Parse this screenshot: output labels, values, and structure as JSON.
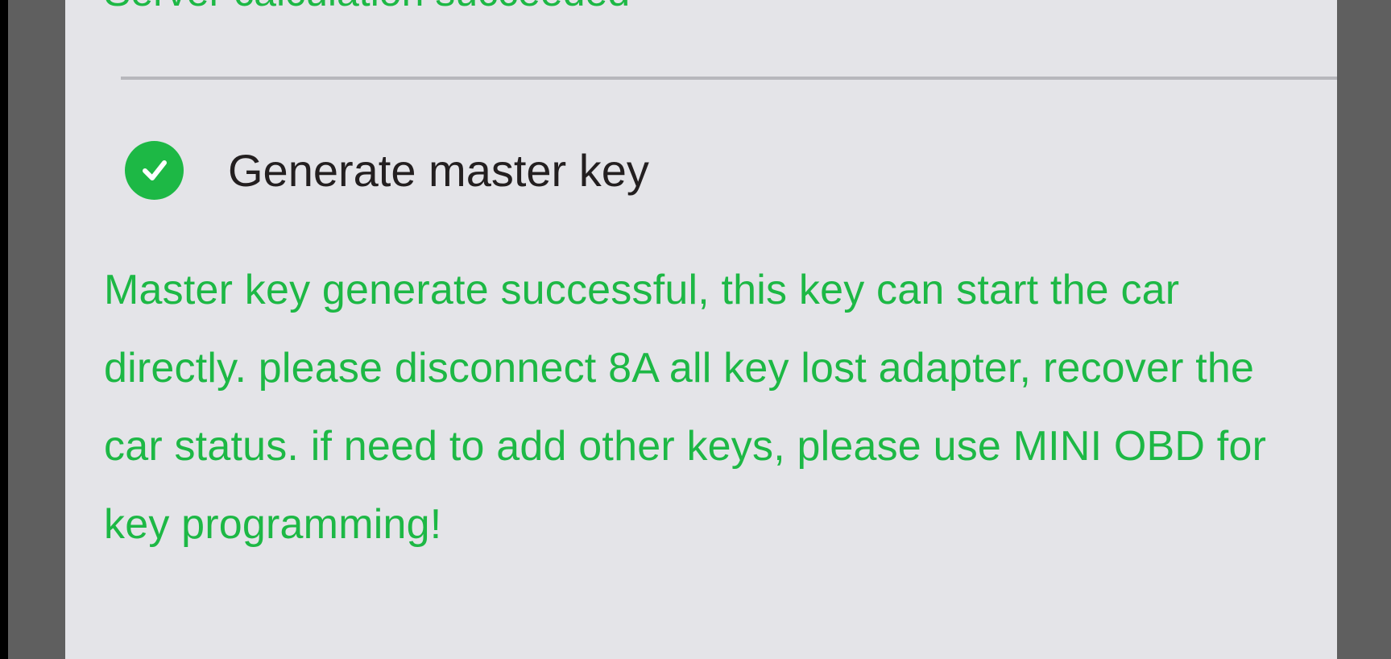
{
  "previous_status": {
    "text": "Server calculation succeeded"
  },
  "step": {
    "icon": "check-circle-icon",
    "label": "Generate master key",
    "state": "completed"
  },
  "result_message": {
    "text": "Master key generate successful, this key can start the car directly. please disconnect 8A all key lost adapter, recover the car status. if need to add other keys, please use MINI OBD for key programming!"
  },
  "colors": {
    "success_green": "#1db845",
    "screen_background": "#e4e4e8",
    "bezel": "#5f5f5f",
    "label_text": "#231f20"
  }
}
